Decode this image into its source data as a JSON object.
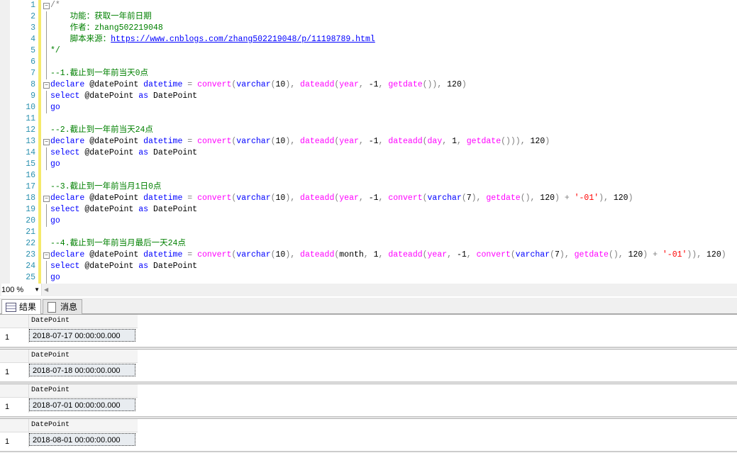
{
  "editor": {
    "lines": [
      [
        [
          "p",
          "/*"
        ]
      ],
      [
        [
          "c",
          "    功能：获取一年前日期"
        ]
      ],
      [
        [
          "c",
          "    作者：zhang502219048"
        ]
      ],
      [
        [
          "c",
          "    脚本来源："
        ],
        [
          "u",
          "https://www.cnblogs.com/zhang502219048/p/11198789.html"
        ]
      ],
      [
        [
          "c",
          "*/"
        ]
      ],
      [],
      [
        [
          "c",
          "--1.截止到一年前当天0点"
        ]
      ],
      [
        [
          "k",
          "declare"
        ],
        [
          "t",
          " @datePoint "
        ],
        [
          "k",
          "datetime"
        ],
        [
          "p",
          " = "
        ],
        [
          "f",
          "convert"
        ],
        [
          "p",
          "("
        ],
        [
          "k",
          "varchar"
        ],
        [
          "p",
          "("
        ],
        [
          "t",
          "10"
        ],
        [
          "p",
          "), "
        ],
        [
          "f",
          "dateadd"
        ],
        [
          "p",
          "("
        ],
        [
          "f",
          "year"
        ],
        [
          "p",
          ", "
        ],
        [
          "t",
          "-1"
        ],
        [
          "p",
          ", "
        ],
        [
          "f",
          "getdate"
        ],
        [
          "p",
          "()), "
        ],
        [
          "t",
          "120"
        ],
        [
          "p",
          ")"
        ]
      ],
      [
        [
          "k",
          "select"
        ],
        [
          "t",
          " @datePoint "
        ],
        [
          "k",
          "as"
        ],
        [
          "t",
          " DatePoint"
        ]
      ],
      [
        [
          "k",
          "go"
        ]
      ],
      [],
      [
        [
          "c",
          "--2.截止到一年前当天24点"
        ]
      ],
      [
        [
          "k",
          "declare"
        ],
        [
          "t",
          " @datePoint "
        ],
        [
          "k",
          "datetime"
        ],
        [
          "p",
          " = "
        ],
        [
          "f",
          "convert"
        ],
        [
          "p",
          "("
        ],
        [
          "k",
          "varchar"
        ],
        [
          "p",
          "("
        ],
        [
          "t",
          "10"
        ],
        [
          "p",
          "), "
        ],
        [
          "f",
          "dateadd"
        ],
        [
          "p",
          "("
        ],
        [
          "f",
          "year"
        ],
        [
          "p",
          ", "
        ],
        [
          "t",
          "-1"
        ],
        [
          "p",
          ", "
        ],
        [
          "f",
          "dateadd"
        ],
        [
          "p",
          "("
        ],
        [
          "f",
          "day"
        ],
        [
          "p",
          ", "
        ],
        [
          "t",
          "1"
        ],
        [
          "p",
          ", "
        ],
        [
          "f",
          "getdate"
        ],
        [
          "p",
          "())), "
        ],
        [
          "t",
          "120"
        ],
        [
          "p",
          ")"
        ]
      ],
      [
        [
          "k",
          "select"
        ],
        [
          "t",
          " @datePoint "
        ],
        [
          "k",
          "as"
        ],
        [
          "t",
          " DatePoint"
        ]
      ],
      [
        [
          "k",
          "go"
        ]
      ],
      [],
      [
        [
          "c",
          "--3.截止到一年前当月1日0点"
        ]
      ],
      [
        [
          "k",
          "declare"
        ],
        [
          "t",
          " @datePoint "
        ],
        [
          "k",
          "datetime"
        ],
        [
          "p",
          " = "
        ],
        [
          "f",
          "convert"
        ],
        [
          "p",
          "("
        ],
        [
          "k",
          "varchar"
        ],
        [
          "p",
          "("
        ],
        [
          "t",
          "10"
        ],
        [
          "p",
          "), "
        ],
        [
          "f",
          "dateadd"
        ],
        [
          "p",
          "("
        ],
        [
          "f",
          "year"
        ],
        [
          "p",
          ", "
        ],
        [
          "t",
          "-1"
        ],
        [
          "p",
          ", "
        ],
        [
          "f",
          "convert"
        ],
        [
          "p",
          "("
        ],
        [
          "k",
          "varchar"
        ],
        [
          "p",
          "("
        ],
        [
          "t",
          "7"
        ],
        [
          "p",
          "), "
        ],
        [
          "f",
          "getdate"
        ],
        [
          "p",
          "(), "
        ],
        [
          "t",
          "120"
        ],
        [
          "p",
          ") + "
        ],
        [
          "s",
          "'-01'"
        ],
        [
          "p",
          "), "
        ],
        [
          "t",
          "120"
        ],
        [
          "p",
          ")"
        ]
      ],
      [
        [
          "k",
          "select"
        ],
        [
          "t",
          " @datePoint "
        ],
        [
          "k",
          "as"
        ],
        [
          "t",
          " DatePoint"
        ]
      ],
      [
        [
          "k",
          "go"
        ]
      ],
      [],
      [
        [
          "c",
          "--4.截止到一年前当月最后一天24点"
        ]
      ],
      [
        [
          "k",
          "declare"
        ],
        [
          "t",
          " @datePoint "
        ],
        [
          "k",
          "datetime"
        ],
        [
          "p",
          " = "
        ],
        [
          "f",
          "convert"
        ],
        [
          "p",
          "("
        ],
        [
          "k",
          "varchar"
        ],
        [
          "p",
          "("
        ],
        [
          "t",
          "10"
        ],
        [
          "p",
          "), "
        ],
        [
          "f",
          "dateadd"
        ],
        [
          "p",
          "("
        ],
        [
          "t",
          "month"
        ],
        [
          "p",
          ", "
        ],
        [
          "t",
          "1"
        ],
        [
          "p",
          ", "
        ],
        [
          "f",
          "dateadd"
        ],
        [
          "p",
          "("
        ],
        [
          "f",
          "year"
        ],
        [
          "p",
          ", "
        ],
        [
          "t",
          "-1"
        ],
        [
          "p",
          ", "
        ],
        [
          "f",
          "convert"
        ],
        [
          "p",
          "("
        ],
        [
          "k",
          "varchar"
        ],
        [
          "p",
          "("
        ],
        [
          "t",
          "7"
        ],
        [
          "p",
          "), "
        ],
        [
          "f",
          "getdate"
        ],
        [
          "p",
          "(), "
        ],
        [
          "t",
          "120"
        ],
        [
          "p",
          ") + "
        ],
        [
          "s",
          "'-01'"
        ],
        [
          "p",
          ")), "
        ],
        [
          "t",
          "120"
        ],
        [
          "p",
          ")"
        ]
      ],
      [
        [
          "k",
          "select"
        ],
        [
          "t",
          " @datePoint "
        ],
        [
          "k",
          "as"
        ],
        [
          "t",
          " DatePoint"
        ]
      ],
      [
        [
          "k",
          "go"
        ]
      ]
    ]
  },
  "status": {
    "zoom": "100 %"
  },
  "tabs": {
    "results": "结果",
    "messages": "消息"
  },
  "results": [
    {
      "column": "DatePoint",
      "row_number": "1",
      "value": "2018-07-17 00:00:00.000"
    },
    {
      "column": "DatePoint",
      "row_number": "1",
      "value": "2018-07-18 00:00:00.000"
    },
    {
      "column": "DatePoint",
      "row_number": "1",
      "value": "2018-07-01 00:00:00.000"
    },
    {
      "column": "DatePoint",
      "row_number": "1",
      "value": "2018-08-01 00:00:00.000"
    }
  ]
}
